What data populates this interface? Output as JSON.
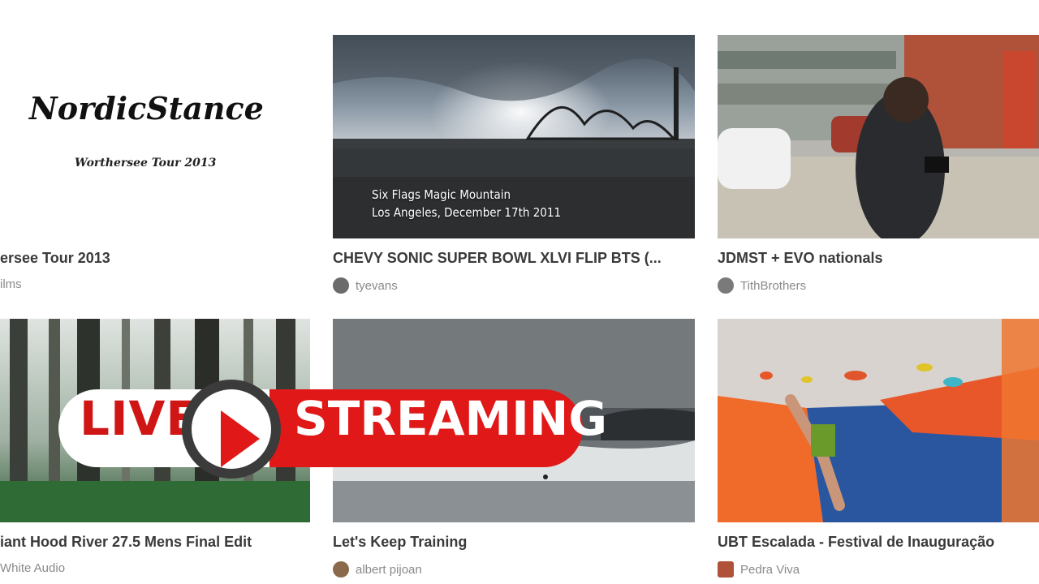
{
  "videos": [
    {
      "title": "ersee Tour 2013",
      "author": "ilms",
      "logo_main": "NordicStance",
      "logo_sub": "Worthersee Tour 2013"
    },
    {
      "title": "CHEVY SONIC SUPER BOWL XLVI FLIP BTS (...",
      "author": "tyevans",
      "overlay_line1": "Six Flags Magic Mountain",
      "overlay_line2": "Los Angeles, December 17th 2011"
    },
    {
      "title": "JDMST + EVO nationals",
      "author": "TithBrothers"
    },
    {
      "title": "iant Hood River 27.5 Mens Final Edit",
      "author": "White Audio"
    },
    {
      "title": "Let's Keep Training",
      "author": "albert pijoan"
    },
    {
      "title": "UBT Escalada - Festival de Inauguração",
      "author": "Pedra Viva"
    }
  ],
  "banner": {
    "live": "LIVE",
    "streaming": "STREAMING",
    "icon": "play-icon",
    "colors": {
      "red": "#e01818",
      "dark": "#3b3b3b",
      "white": "#ffffff"
    }
  }
}
